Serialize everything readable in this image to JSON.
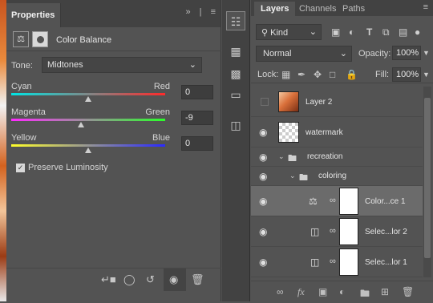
{
  "properties_panel": {
    "tab_label": "Properties",
    "adjustment_title": "Color Balance",
    "tone_label": "Tone:",
    "tone_value": "Midtones",
    "sliders": [
      {
        "left": "Cyan",
        "right": "Red",
        "value": "0",
        "level": 0
      },
      {
        "left": "Magenta",
        "right": "Green",
        "value": "-9",
        "level": -9
      },
      {
        "left": "Yellow",
        "right": "Blue",
        "value": "0",
        "level": 0
      }
    ],
    "preserve_luminosity_label": "Preserve Luminosity",
    "preserve_luminosity_checked": true
  },
  "layers_panel": {
    "tabs": [
      "Layers",
      "Channels",
      "Paths"
    ],
    "filter_kind": "Kind",
    "blend_mode": "Normal",
    "opacity_label": "Opacity:",
    "opacity_value": "100%",
    "lock_label": "Lock:",
    "fill_label": "Fill:",
    "fill_value": "100%",
    "layers": [
      {
        "name": "Layer 2",
        "visible": false,
        "type": "pixel"
      },
      {
        "name": "watermark",
        "visible": true,
        "type": "pixel"
      },
      {
        "name": "recreation",
        "visible": true,
        "type": "group"
      },
      {
        "name": "coloring",
        "visible": true,
        "type": "group"
      },
      {
        "name": "Color...ce 1",
        "visible": true,
        "type": "color-balance",
        "selected": true
      },
      {
        "name": "Selec...lor 2",
        "visible": true,
        "type": "selective-color"
      },
      {
        "name": "Selec...lor 1",
        "visible": true,
        "type": "selective-color"
      }
    ]
  },
  "colors": {
    "panel_bg": "#535353",
    "tab_bar_bg": "#424242",
    "selected_row_bg": "#6b6b6b"
  }
}
